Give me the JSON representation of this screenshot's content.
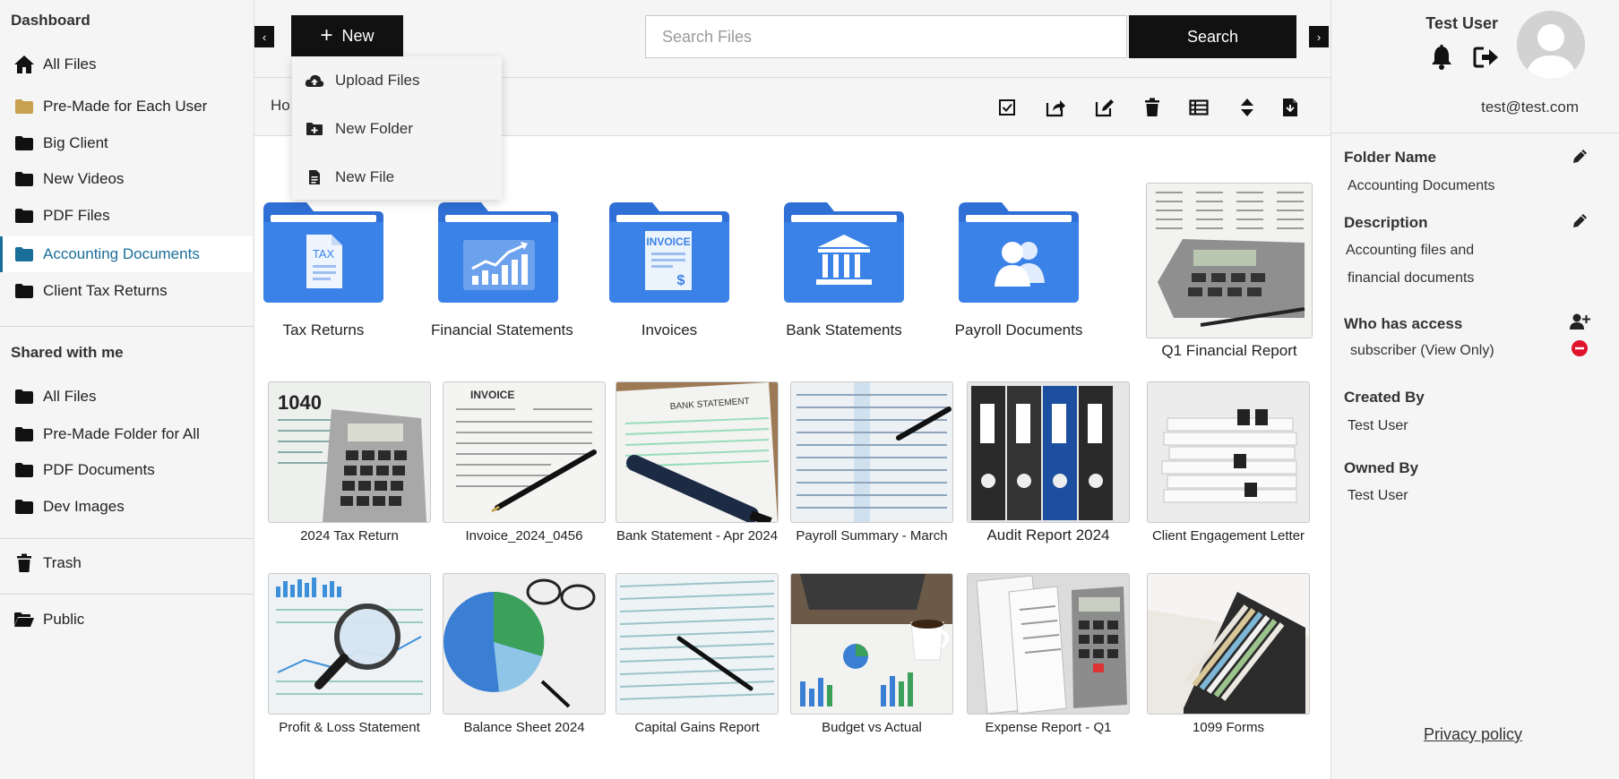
{
  "sidebar": {
    "dashboard_label": "Dashboard",
    "my_items": [
      {
        "label": "All Files",
        "icon": "home-icon"
      },
      {
        "label": "Pre-Made for Each User",
        "icon": "folder-icon"
      },
      {
        "label": "Big Client",
        "icon": "folder-icon"
      },
      {
        "label": "New Videos",
        "icon": "folder-icon"
      },
      {
        "label": "PDF Files",
        "icon": "folder-icon"
      },
      {
        "label": "Accounting Documents",
        "icon": "folder-icon",
        "active": true
      },
      {
        "label": "Client Tax Returns",
        "icon": "folder-icon"
      }
    ],
    "shared_heading": "Shared with me",
    "shared_items": [
      {
        "label": "All Files"
      },
      {
        "label": "Pre-Made Folder for All"
      },
      {
        "label": "PDF Documents"
      },
      {
        "label": "Dev Images"
      }
    ],
    "trash_label": "Trash",
    "public_label": "Public"
  },
  "topbar": {
    "new_label": "New",
    "search_placeholder": "Search Files",
    "search_label": "Search",
    "prev_arrow": "‹",
    "next_arrow": "›"
  },
  "new_menu": {
    "items": [
      {
        "label": "Upload Files",
        "icon": "cloud-upload-icon"
      },
      {
        "label": "New Folder",
        "icon": "folder-plus-icon"
      },
      {
        "label": "New File",
        "icon": "file-icon"
      }
    ]
  },
  "toolbar": {
    "breadcrumb": "Ho",
    "tools": [
      "checkbox-icon",
      "share-icon",
      "edit-icon",
      "trash-icon",
      "table-icon",
      "sort-icon",
      "export-file-icon"
    ]
  },
  "folders": [
    {
      "label": "Tax Returns",
      "icon": "tax-document-icon"
    },
    {
      "label": "Financial Statements",
      "icon": "chart-icon"
    },
    {
      "label": "Invoices",
      "icon": "invoice-icon"
    },
    {
      "label": "Bank Statements",
      "icon": "bank-icon"
    },
    {
      "label": "Payroll Documents",
      "icon": "people-icon"
    }
  ],
  "files": [
    {
      "label": "Q1 Financial Report"
    },
    {
      "label": "2024 Tax Return"
    },
    {
      "label": "Invoice_2024_0456"
    },
    {
      "label": "Bank Statement - Apr 2024"
    },
    {
      "label": "Payroll Summary - March"
    },
    {
      "label": "Audit Report 2024"
    },
    {
      "label": "Client Engagement Letter"
    },
    {
      "label": "Profit & Loss Statement"
    },
    {
      "label": "Balance Sheet 2024"
    },
    {
      "label": "Capital Gains Report"
    },
    {
      "label": "Budget vs Actual"
    },
    {
      "label": "Expense Report - Q1"
    },
    {
      "label": "1099 Forms"
    }
  ],
  "user": {
    "name": "Test User",
    "email": "test@test.com"
  },
  "details": {
    "folder_name_label": "Folder Name",
    "folder_name_value": "Accounting Documents",
    "description_label": "Description",
    "description_line1": "Accounting files and",
    "description_line2": "financial documents",
    "access_label": "Who has access",
    "access_value": "subscriber (View Only)",
    "created_by_label": "Created By",
    "created_by_value": "Test User",
    "owned_by_label": "Owned By",
    "owned_by_value": "Test User"
  },
  "privacy_label": "Privacy policy",
  "colors": {
    "accent": "#1a6e9a",
    "folder_blue": "#3b82e8",
    "folder_gold": "#c9a04e",
    "remove_red": "#e0132c"
  }
}
